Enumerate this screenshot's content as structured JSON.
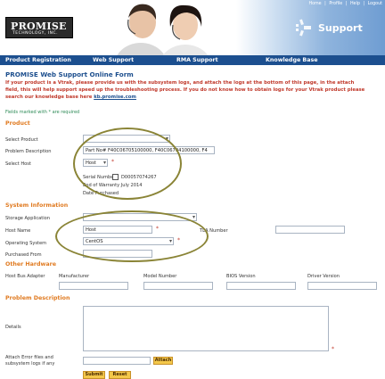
{
  "header": {
    "logo_line1": "PROMISE",
    "logo_line2": "TECHNOLOGY, INC.",
    "support_word": "Support",
    "top_links": [
      "Home",
      "|",
      "Profile",
      "|",
      "Help",
      "|",
      "Logout"
    ]
  },
  "nav": {
    "items": [
      "Product Registration",
      "Web Support",
      "RMA Support",
      "Knowledge Base"
    ]
  },
  "form": {
    "title": "PROMISE Web Support Online Form",
    "intro_line1": "If your product is a Vtrak, please provide us with the subsystem logs, and attach the logs at the bottom of this page, in the attach",
    "intro_line2": "field, this will help support speed up the troubleshooting process. If you do not know how to obtain logs for your Vtrak product please",
    "intro_line3_prefix": "search our knowledge base here ",
    "intro_link": "kb.promise.com",
    "required_note": "Fields marked with * are required"
  },
  "product": {
    "heading": "Product",
    "select_product_label": "Select Product",
    "problem_desc_label": "Problem Description",
    "problem_desc_value": "Part No# F40C06705100000, F40C06704100000, F4",
    "select_host_label": "Select Host",
    "select_host_value": "Host",
    "serial_label": "Serial Number",
    "serial_value": "D00057074267",
    "warranty_text": "End of Warranty July 2014",
    "date_purchased": "Date Purchased"
  },
  "system": {
    "heading": "System Information",
    "storage_app_label": "Storage Application",
    "host_name_label": "Host Name",
    "host_name_value": "Host",
    "tla_label": "TLA Number",
    "os_label": "Operating System",
    "os_value": "CentOS",
    "purchased_from_label": "Purchased From"
  },
  "other_hardware": {
    "heading": "Other Hardware",
    "columns": [
      "Host Bus Adapter",
      "Manufacturer",
      "Model Number",
      "BIOS Version",
      "Driver Version"
    ]
  },
  "problem": {
    "heading": "Problem Description",
    "details_label": "Details",
    "attach_label_line1": "Attach Error files and",
    "attach_label_line2": "subsystem logs if any",
    "attach_button": "Attach",
    "submit_button": "Submit",
    "reset_button": "Reset"
  },
  "colors": {
    "nav_bg": "#1c4f8f",
    "section_orange": "#e07a20",
    "intro_red": "#c0392b",
    "button_yellow": "#f4c84a",
    "highlight_olive": "#8a8436"
  }
}
